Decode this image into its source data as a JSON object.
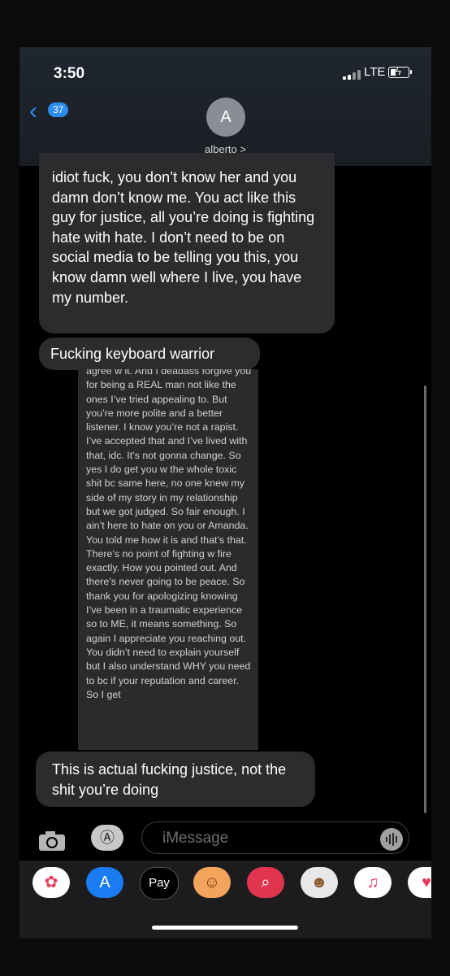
{
  "status_bar": {
    "time": "3:50",
    "network": "LTE"
  },
  "nav": {
    "back_count": "37",
    "avatar_initial": "A",
    "contact_name": "alberto >"
  },
  "messages": [
    {
      "text": "idiot fuck, you don’t know her and you damn don’t know me. You act like this guy for justice, all you’re doing is fighting hate with hate. I don’t need to be on social media to be telling you this, you know damn well where I live, you have my number."
    },
    {
      "text": "Fucking keyboard warrior"
    },
    {
      "text": "This is actual fucking justice, not the shit you’re doing"
    }
  ],
  "screenshot_text": "agree w it. And I deadass forgive you for being a REAL man not like the ones I’ve tried appealing to. But you’re more polite and a better listener. I know you’re not a rapist. I’ve accepted that and I’ve lived with that, idc. It’s not gonna change. So yes I do get you w the whole toxic shit bc same here, no one knew my side of my story in my relationship but we got judged. So fair enough. I ain’t here to hate on you or Amanda. You told me how it is and that’s that. There’s no point of fighting w fire exactly. How you pointed out. And there’s never going to be peace. So thank you for apologizing knowing I’ve been in a traumatic experience so to ME, it means something. So again I appreciate you reaching out. You didn’t need to explain yourself but I also understand WHY you need to bc if your reputation and career. So I get",
  "input": {
    "placeholder": "iMessage"
  },
  "dock": {
    "apple_pay_label": "Pay"
  },
  "colors": {
    "accent": "#2d8cf0",
    "bubble": "#2c2c2e",
    "background": "#000000"
  }
}
